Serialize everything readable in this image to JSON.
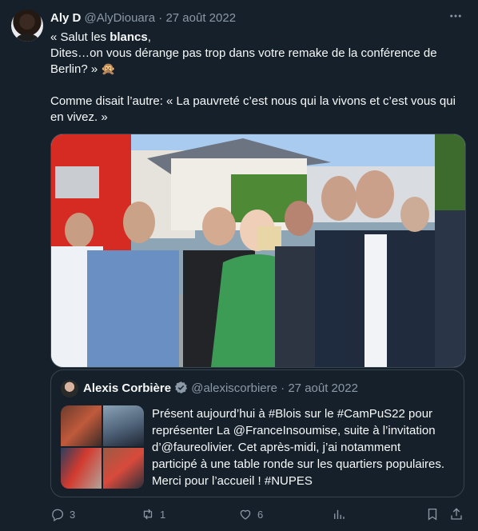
{
  "author": {
    "name": "Aly D",
    "handle": "@AlyDiouara",
    "separator": "·",
    "date": "27 août 2022"
  },
  "tweet": {
    "line1_pre": "« Salut les ",
    "line1_bold": "blancs",
    "line1_post": ",",
    "line2": "Dites…on vous dérange pas trop dans votre remake de la conférence de",
    "line3": "Berlin? »",
    "line3_emoji": "🙊",
    "line4": "Comme disait l’autre: « La pauvreté c’est nous qui la vivons et c’est vous qui",
    "line5": "en vivez. »"
  },
  "more_icon": "more-horizontal-icon",
  "quoted": {
    "name": "Alexis Corbière",
    "handle": "@alexiscorbiere",
    "separator": "·",
    "date": "27 août 2022",
    "verified_color": "#8b98a5",
    "text_lines": [
      "Présent aujourd’hui à #Blois sur le #CamPuS22 pour",
      "représenter La @FranceInsoumise, suite à l’invitation",
      "d’@faureolivier. Cet après-midi, j’ai notamment",
      "participé à une table ronde sur les quartiers populaires.",
      "Merci pour l’accueil ! #NUPES"
    ]
  },
  "actions": {
    "reply_count": "3",
    "retweet_count": "1",
    "like_count": "6"
  },
  "colors": {
    "background": "#15202b",
    "text": "#f7f9f9",
    "muted": "#8b98a5",
    "border": "#38444d"
  }
}
